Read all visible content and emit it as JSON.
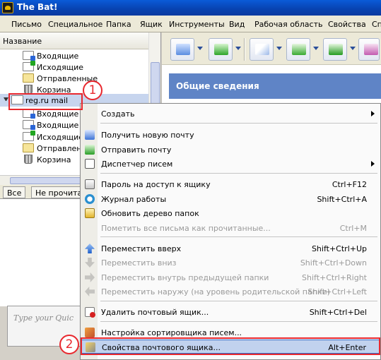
{
  "window": {
    "title": "The Bat!"
  },
  "menubar": {
    "items": [
      "Письмо",
      "Специальное",
      "Папка",
      "Ящик",
      "Инструменты",
      "Вид",
      "Рабочая область",
      "Свойства",
      "Сп"
    ]
  },
  "folder_tree": {
    "header": "Название",
    "group1": [
      "Входящие",
      "Исходящие",
      "Отправленные",
      "Корзина"
    ],
    "account": "reg.ru mail",
    "group2": [
      "Входящие -",
      "Входящие",
      "Исходящие",
      "Отправлен",
      "Корзина"
    ]
  },
  "filter_tabs": [
    "Все",
    "Не прочитан"
  ],
  "quick_text": {
    "placeholder": "Type your Quic"
  },
  "info_panel": {
    "title": "Общие сведения"
  },
  "toolbar": {
    "buttons": [
      "get-mail",
      "send-mail",
      "new-message",
      "reply",
      "reply-all",
      "forward"
    ]
  },
  "context_menu": {
    "items": [
      {
        "label": "Создать",
        "shortcut": "",
        "icon": "",
        "submenu": true,
        "disabled": false
      },
      {
        "label": "Получить новую почту",
        "shortcut": "",
        "icon": "get-mail-icon",
        "disabled": false
      },
      {
        "label": "Отправить почту",
        "shortcut": "",
        "icon": "send-mail-icon",
        "disabled": false
      },
      {
        "label": "Диспетчер писем",
        "shortcut": "",
        "icon": "dispatcher-icon",
        "submenu": true,
        "disabled": false
      },
      {
        "label": "Пароль на доступ к ящику",
        "shortcut": "Ctrl+F12",
        "icon": "lock-icon",
        "disabled": false
      },
      {
        "label": "Журнал работы",
        "shortcut": "Shift+Ctrl+A",
        "icon": "log-icon",
        "disabled": false
      },
      {
        "label": "Обновить дерево папок",
        "shortcut": "",
        "icon": "refresh-icon",
        "disabled": false
      },
      {
        "label": "Пометить все письма как прочитанные...",
        "shortcut": "Ctrl+M",
        "icon": "",
        "disabled": true
      },
      {
        "label": "Переместить вверх",
        "shortcut": "Shift+Ctrl+Up",
        "icon": "arrow-up-icon",
        "disabled": false
      },
      {
        "label": "Переместить вниз",
        "shortcut": "Shift+Ctrl+Down",
        "icon": "arrow-down-icon",
        "disabled": true
      },
      {
        "label": "Переместить внутрь предыдущей папки",
        "shortcut": "Shift+Ctrl+Right",
        "icon": "arrow-right-icon",
        "disabled": true
      },
      {
        "label": "Переместить наружу (на уровень родительской папки)",
        "shortcut": "Shift+Ctrl+Left",
        "icon": "arrow-left-icon",
        "disabled": true
      },
      {
        "label": "Удалить почтовый ящик...",
        "shortcut": "Shift+Ctrl+Del",
        "icon": "delete-icon",
        "disabled": false
      },
      {
        "label": "Настройка сортировщика писем...",
        "shortcut": "",
        "icon": "sorter-icon",
        "disabled": false
      },
      {
        "label": "Свойства почтового ящика...",
        "shortcut": "Alt+Enter",
        "icon": "properties-icon",
        "disabled": false,
        "highlighted": true
      }
    ]
  },
  "annotations": {
    "step1": "1",
    "step2": "2"
  },
  "colors": {
    "title_bar": "#0a5bd8",
    "menu_highlight": "#c1d2ee",
    "callout": "#e8282e",
    "panel_band": "#5f84c6"
  }
}
